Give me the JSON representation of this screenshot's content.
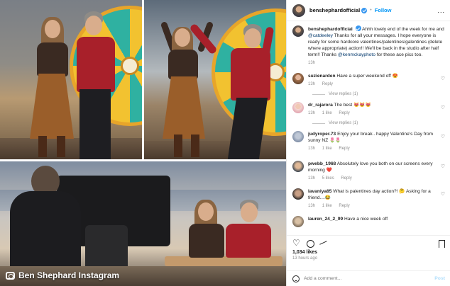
{
  "caption": {
    "text": "Ben Shephard Instagram",
    "icon": "camera-icon"
  },
  "post": {
    "username": "benshephardofficial",
    "follow_label": "Follow",
    "separator": "•",
    "more_label": "...",
    "caption": {
      "username": "benshephardofficial",
      "text_before": "Ahhh lovely end of the week for me and ",
      "mention1": "@catdeeley",
      "text_middle": " Thanks for all your messages. I hope everyone is ready for some hardcore valentines/palentines/galentines (delete where appropriate) action!! We'll be back in the studio after half term!! Thanks ",
      "mention2": "@kenmckayphoto",
      "text_after": " for these ace pics too.",
      "time": "13h"
    },
    "comments": [
      {
        "username": "suzienarden",
        "text": "Have a super weekend off 😍",
        "time": "13h",
        "likes": "",
        "reply": "Reply",
        "view_replies": "View replies (1)"
      },
      {
        "username": "dr_rajarora",
        "text": "The best 😻😻😻",
        "time": "13h",
        "likes": "1 like",
        "reply": "Reply",
        "view_replies": "View replies (1)"
      },
      {
        "username": "judyroper.73",
        "text": "Enjoy your break.. happy Valentine's Day from sunny NZ 🌷🌷",
        "time": "13h",
        "likes": "1 like",
        "reply": "Reply",
        "view_replies": ""
      },
      {
        "username": "pwebb_1968",
        "text": "Absolutely love you both on our screens every morning ❤️",
        "time": "13h",
        "likes": "5 likes",
        "reply": "Reply",
        "view_replies": ""
      },
      {
        "username": "lavaniya85",
        "text": "What is palentines day action?! 🤔 Asking for a friend....😂",
        "time": "13h",
        "likes": "1 like",
        "reply": "Reply",
        "view_replies": ""
      },
      {
        "username": "lauren_24_2_99",
        "text": "Have a nice week off",
        "time": "",
        "likes": "",
        "reply": "",
        "view_replies": ""
      }
    ],
    "likes_count": "1,034 likes",
    "timestamp": "13 hours ago",
    "add_comment_placeholder": "Add a comment...",
    "post_button": "Post"
  }
}
